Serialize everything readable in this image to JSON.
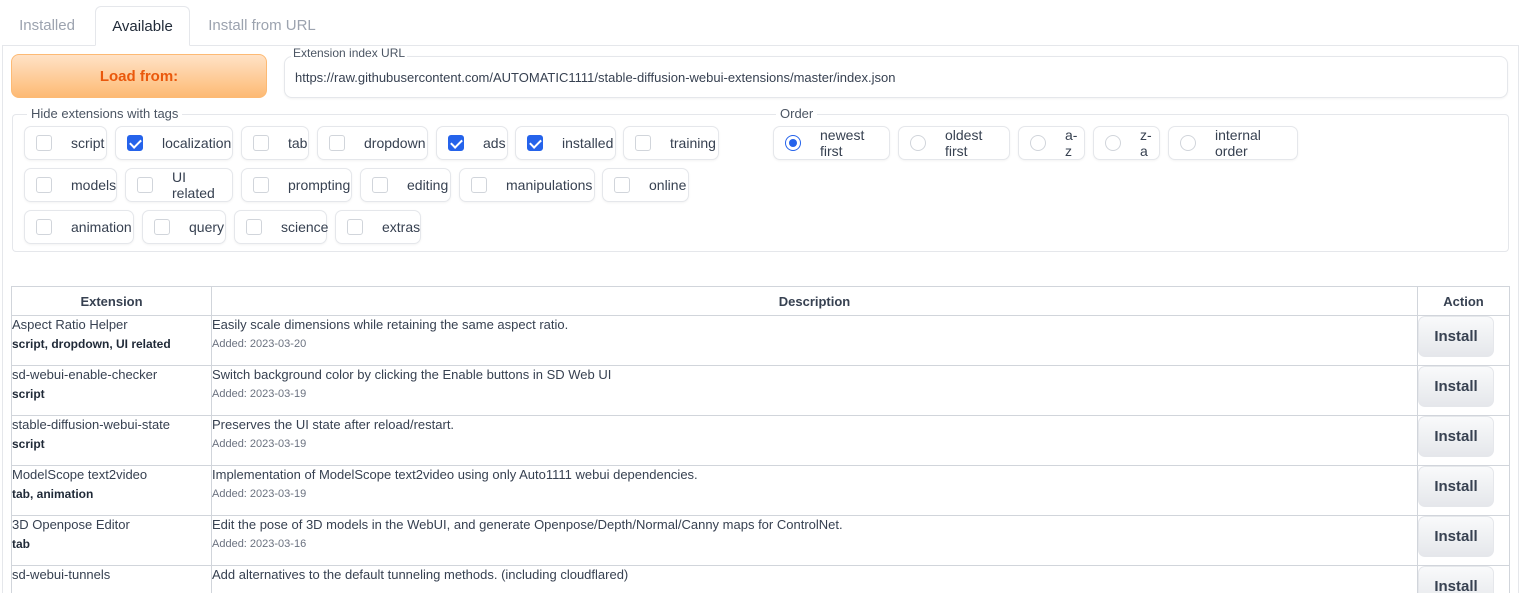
{
  "tabs": [
    {
      "label": "Installed"
    },
    {
      "label": "Available"
    },
    {
      "label": "Install from URL"
    }
  ],
  "load_button": "Load from:",
  "url_field": {
    "label": "Extension index URL",
    "value": "https://raw.githubusercontent.com/AUTOMATIC1111/stable-diffusion-webui-extensions/master/index.json"
  },
  "hide_tags": {
    "label": "Hide extensions with tags",
    "items": [
      {
        "label": "script",
        "checked": false
      },
      {
        "label": "localization",
        "checked": true
      },
      {
        "label": "tab",
        "checked": false
      },
      {
        "label": "dropdown",
        "checked": false
      },
      {
        "label": "ads",
        "checked": true
      },
      {
        "label": "installed",
        "checked": true
      },
      {
        "label": "training",
        "checked": false
      },
      {
        "label": "models",
        "checked": false
      },
      {
        "label": "UI related",
        "checked": false
      },
      {
        "label": "prompting",
        "checked": false
      },
      {
        "label": "editing",
        "checked": false
      },
      {
        "label": "manipulations",
        "checked": false
      },
      {
        "label": "online",
        "checked": false
      },
      {
        "label": "animation",
        "checked": false
      },
      {
        "label": "query",
        "checked": false
      },
      {
        "label": "science",
        "checked": false
      },
      {
        "label": "extras",
        "checked": false
      }
    ]
  },
  "order": {
    "label": "Order",
    "items": [
      {
        "label": "newest first",
        "checked": true
      },
      {
        "label": "oldest first",
        "checked": false
      },
      {
        "label": "a-z",
        "checked": false
      },
      {
        "label": "z-a",
        "checked": false
      },
      {
        "label": "internal order",
        "checked": false
      }
    ]
  },
  "table": {
    "headers": [
      "Extension",
      "Description",
      "Action"
    ],
    "rows": [
      {
        "name": "Aspect Ratio Helper",
        "tags": "script, dropdown, UI related",
        "description": "Easily scale dimensions while retaining the same aspect ratio.",
        "added": "Added: 2023-03-20",
        "action": "Install"
      },
      {
        "name": "sd-webui-enable-checker",
        "tags": "script",
        "description": "Switch background color by clicking the Enable buttons in SD Web UI",
        "added": "Added: 2023-03-19",
        "action": "Install"
      },
      {
        "name": "stable-diffusion-webui-state",
        "tags": "script",
        "description": "Preserves the UI state after reload/restart.",
        "added": "Added: 2023-03-19",
        "action": "Install"
      },
      {
        "name": "ModelScope text2video",
        "tags": "tab, animation",
        "description": "Implementation of ModelScope text2video using only Auto1111 webui dependencies.",
        "added": "Added: 2023-03-19",
        "action": "Install"
      },
      {
        "name": "3D Openpose Editor",
        "tags": "tab",
        "description": "Edit the pose of 3D models in the WebUI, and generate Openpose/Depth/Normal/Canny maps for ControlNet.",
        "added": "Added: 2023-03-16",
        "action": "Install"
      },
      {
        "name": "sd-webui-tunnels",
        "tags": "",
        "description": "Add alternatives to the default tunneling methods. (including cloudflared)",
        "added": "",
        "action": "Install"
      }
    ]
  }
}
